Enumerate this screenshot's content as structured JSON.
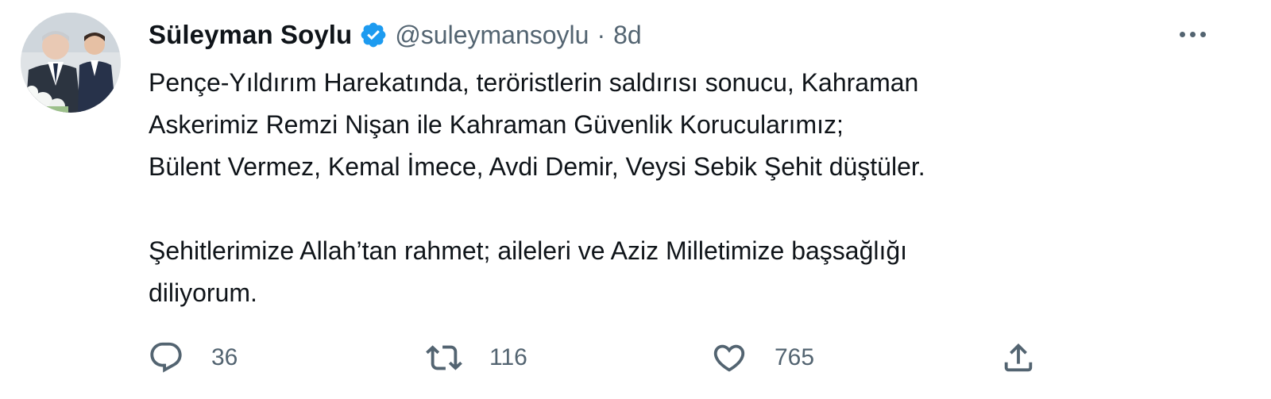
{
  "tweet": {
    "author": {
      "display_name": "Süleyman Soylu",
      "handle": "@suleymansoylu",
      "verified": true,
      "avatar": "profile-photo"
    },
    "timestamp": "8d",
    "separator": "·",
    "text": {
      "line1": "Pençe-Yıldırım Harekatında, teröristlerin saldırısı sonucu, Kahraman",
      "line2": "Askerimiz Remzi Nişan ile Kahraman Güvenlik Korucularımız;",
      "line3": "Bülent Vermez, Kemal İmece, Avdi Demir, Veysi Sebik Şehit düştüler.",
      "line4": "Şehitlerimize Allah’tan rahmet; aileleri ve Aziz Milletimize başsağlığı",
      "line5": "diliyorum."
    },
    "actions": {
      "reply": {
        "icon": "reply-icon",
        "count": "36"
      },
      "retweet": {
        "icon": "retweet-icon",
        "count": "116"
      },
      "like": {
        "icon": "heart-icon",
        "count": "765"
      },
      "share": {
        "icon": "share-icon"
      },
      "more": {
        "icon": "more-icon"
      }
    },
    "colors": {
      "text": "#0f1419",
      "secondary": "#536471",
      "verified_badge": "#1d9bf0"
    }
  }
}
